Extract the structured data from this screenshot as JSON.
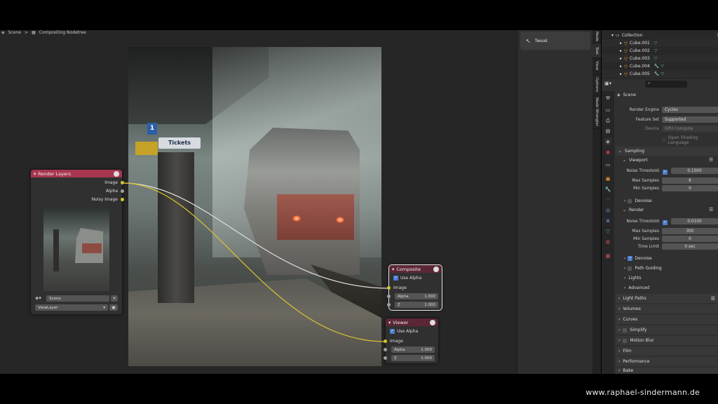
{
  "breadcrumb": {
    "scene": "Scene",
    "sep": ">",
    "tree": "Compositing Nodetree"
  },
  "backdrop": {
    "sign_number": "1",
    "sign_tickets": "Tickets"
  },
  "nodes": {
    "render_layers": {
      "title": "Render Layers",
      "outputs": [
        "Image",
        "Alpha",
        "Noisy Image"
      ],
      "scene": "Scene",
      "view_layer": "ViewLayer",
      "header_color": "#a83650"
    },
    "composite": {
      "title": "Composite",
      "use_alpha": "Use Alpha",
      "image": "Image",
      "alpha_label": "Alpha",
      "alpha_value": "1.000",
      "z_label": "Z",
      "z_value": "1.000",
      "header_color": "#5c2735"
    },
    "viewer": {
      "title": "Viewer",
      "use_alpha": "Use Alpha",
      "image": "Image",
      "alpha_label": "Alpha",
      "alpha_value": "1.000",
      "z_label": "Z",
      "z_value": "1.000",
      "header_color": "#5c2735"
    }
  },
  "tool": {
    "label": "Tweak"
  },
  "vertical_tabs": [
    "Node",
    "Tool",
    "View",
    "Options",
    "Node Wrangler"
  ],
  "outliner": {
    "collection": "Collection",
    "items": [
      "Cube.001",
      "Cube.002",
      "Cube.003",
      "Cube.004",
      "Cube.005"
    ]
  },
  "properties": {
    "context": "Scene",
    "render_engine_label": "Render Engine",
    "render_engine": "Cycles",
    "feature_set_label": "Feature Set",
    "feature_set": "Supported",
    "device_label": "Device",
    "device": "GPU Compute",
    "osl_label": "Open Shading Language",
    "sampling": "Sampling",
    "viewport": "Viewport",
    "vp_noise_label": "Noise Threshold",
    "vp_noise": "0.1000",
    "vp_max_label": "Max Samples",
    "vp_max": "8",
    "vp_min_label": "Min Samples",
    "vp_min": "0",
    "vp_denoise": "Denoise",
    "render": "Render",
    "r_noise_label": "Noise Threshold",
    "r_noise": "0.0100",
    "r_max_label": "Max Samples",
    "r_max": "300",
    "r_min_label": "Min Samples",
    "r_min": "0",
    "r_time_label": "Time Limit",
    "r_time": "0 sec",
    "r_denoise": "Denoise",
    "path_guiding": "Path Guiding",
    "lights": "Lights",
    "advanced": "Advanced",
    "sections": [
      "Light Paths",
      "Volumes",
      "Curves",
      "Simplify",
      "Motion Blur",
      "Film",
      "Performance",
      "Bake"
    ]
  },
  "credit": "www.raphael-sindermann.de"
}
